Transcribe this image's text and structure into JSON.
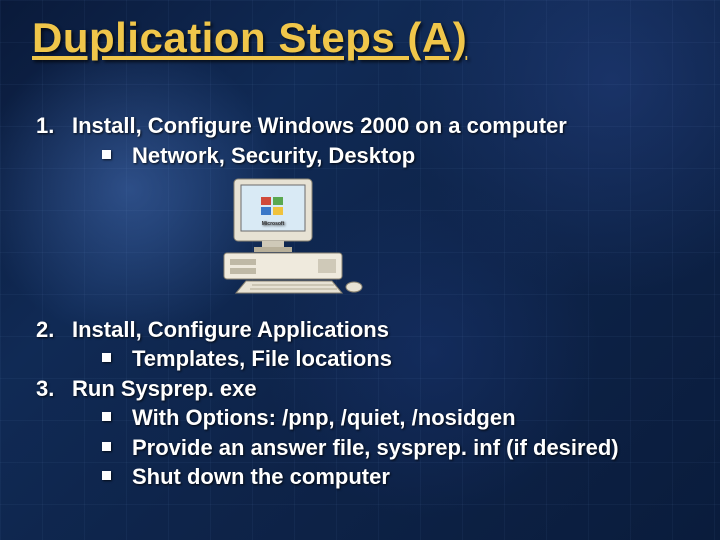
{
  "title": "Duplication Steps (A)",
  "items": [
    {
      "num": "1.",
      "text": "Install, Configure Windows 2000 on a computer",
      "subs": [
        "Network, Security, Desktop"
      ],
      "image_after": true
    },
    {
      "num": "2.",
      "text": "Install, Configure Applications",
      "subs": [
        "Templates, File locations"
      ]
    },
    {
      "num": "3.",
      "text": "Run Sysprep. exe",
      "subs": [
        "With Options:   /pnp, /quiet, /nosidgen",
        "Provide an answer file, sysprep. inf (if desired)",
        "Shut down the computer"
      ]
    }
  ],
  "image_alt": "Desktop computer with monitor showing Windows logo"
}
